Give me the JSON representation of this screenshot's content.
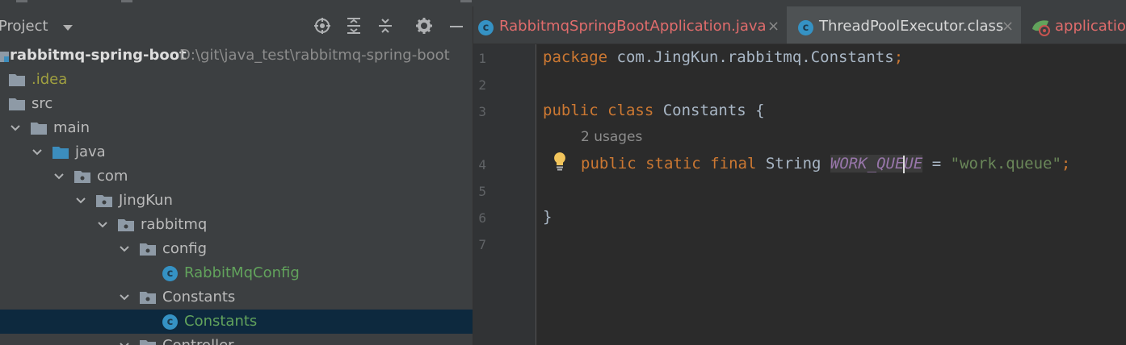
{
  "project_panel": {
    "title": "Project",
    "tree": [
      {
        "label": "rabbitmq-spring-boot",
        "path": "D:\\git\\java_test\\rabbitmq-spring-boot"
      },
      {
        "label": ".idea"
      },
      {
        "label": "src"
      },
      {
        "label": "main"
      },
      {
        "label": "java"
      },
      {
        "label": "com"
      },
      {
        "label": "JingKun"
      },
      {
        "label": "rabbitmq"
      },
      {
        "label": "config"
      },
      {
        "label": "RabbitMqConfig"
      },
      {
        "label": "Constants"
      },
      {
        "label": "Constants"
      },
      {
        "label": "Controller"
      }
    ]
  },
  "tabs": [
    {
      "label": "RabbitmqSpringBootApplication.java",
      "close": "×"
    },
    {
      "label": "ThreadPoolExecutor.class",
      "close": "×"
    },
    {
      "label": "application"
    }
  ],
  "editor": {
    "line_numbers": [
      "1",
      "2",
      "3",
      "4",
      "5",
      "6",
      "7"
    ],
    "usages_hint": "2 usages",
    "line1": {
      "kw": "package",
      "rest": " com.JingKun.rabbitmq.Constants",
      "semi": ";"
    },
    "line3": {
      "kw1": "public",
      "kw2": "class",
      "name": " Constants {"
    },
    "line4": {
      "kw1": "public",
      "kw2": "static",
      "kw3": "final",
      "type": " String ",
      "const_a": "WORK_QUE",
      "const_b": "UE",
      "eq": " = ",
      "str": "\"work.queue\"",
      "semi": ";"
    },
    "line6": "}"
  },
  "colors": {
    "keyword": "#cc7832",
    "string": "#6a8759",
    "constant": "#9876aa",
    "selection": "#0d293e",
    "modified_tab": "#e06c6c",
    "green_file": "#62a35c",
    "olive_folder": "#a0a040"
  },
  "icons": [
    "locate-icon",
    "expand-all-icon",
    "collapse-all-icon",
    "gear-icon",
    "minimize-icon",
    "folder-icon",
    "package-icon",
    "class-icon",
    "bulb-icon",
    "spring-icon"
  ]
}
